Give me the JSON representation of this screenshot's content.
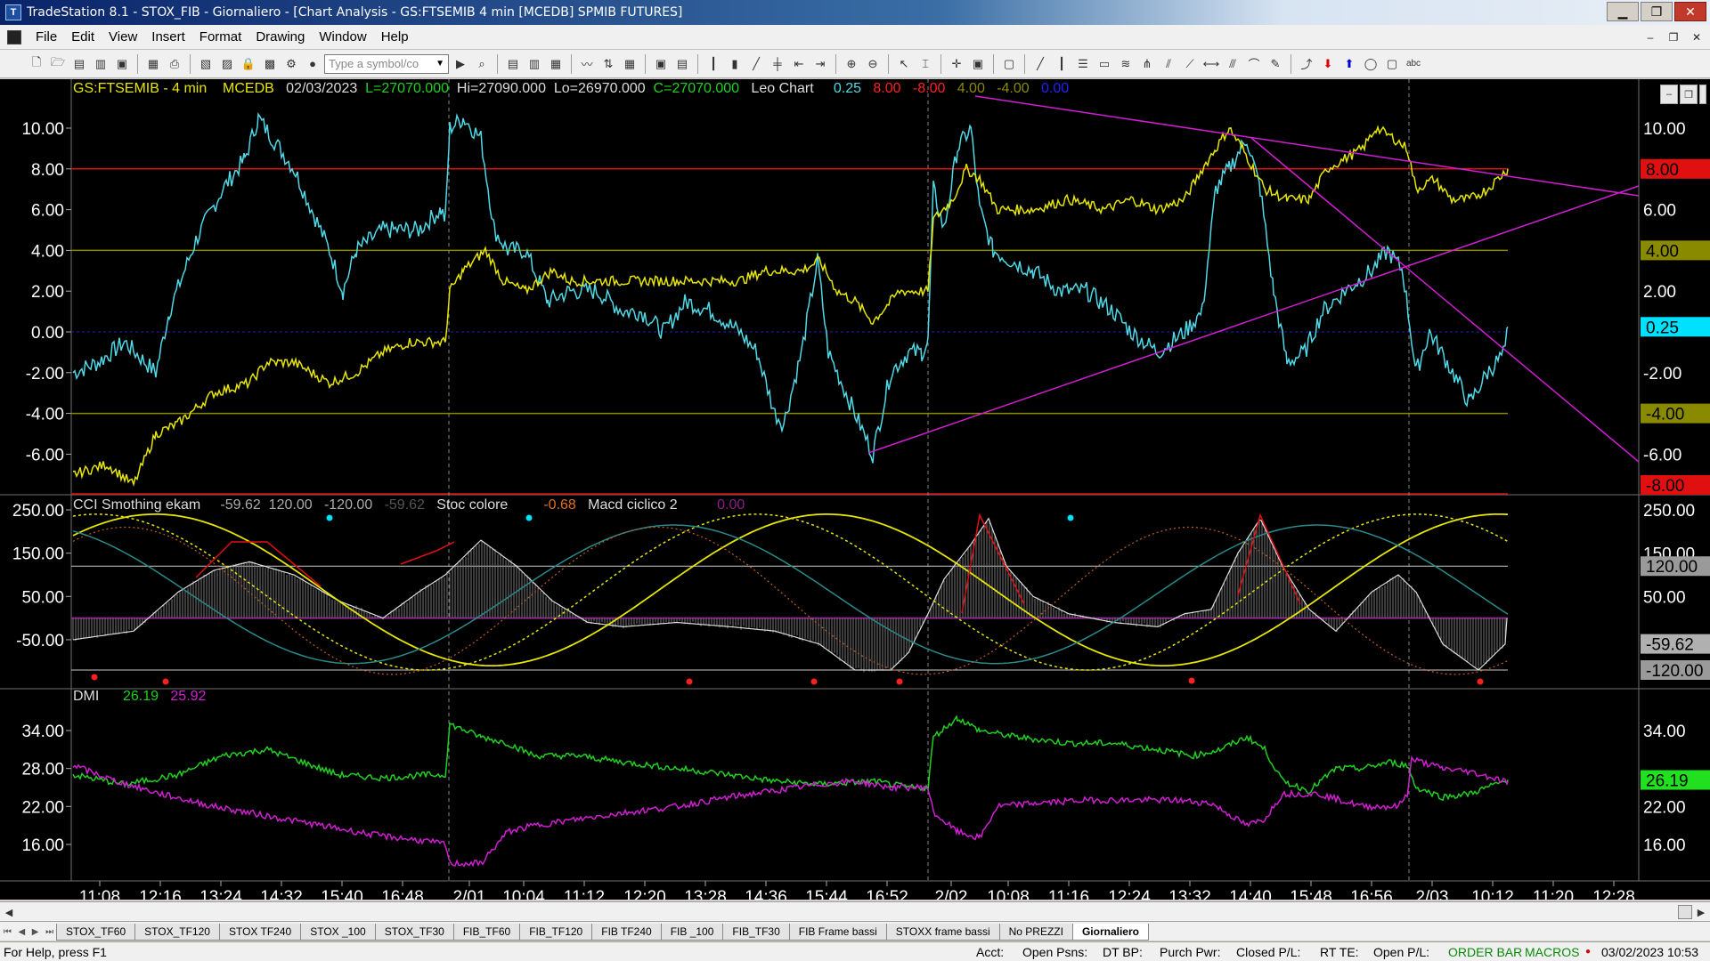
{
  "window": {
    "title": "TradeStation 8.1 - STOX_FIB - Giornaliero - [Chart Analysis - GS:FTSEMIB  4 min  [MCEDB] SPMIB FUTURES]",
    "min": "▁",
    "max": "❐",
    "close": "✕"
  },
  "menu": [
    "File",
    "Edit",
    "View",
    "Insert",
    "Format",
    "Drawing",
    "Window",
    "Help"
  ],
  "toolbar": {
    "symbol_placeholder": "Type a symbol/co"
  },
  "chart": {
    "header": {
      "symbol": "GS:FTSEMIB - 4 min",
      "source": "MCEDB",
      "date": "02/03/2023",
      "last": "L=27070.000",
      "hi": "Hi=27090.000",
      "lo": "Lo=26970.000",
      "close": "C=27070.000",
      "study": "Leo Chart",
      "v1": "0.25",
      "v2": "8.00",
      "v3": "-8.00",
      "v4": "4.00",
      "v5": "-4.00",
      "v6": "0.00"
    },
    "pane1": {
      "yticks": [
        "10.00",
        "8.00",
        "6.00",
        "4.00",
        "2.00",
        "0.00",
        "-2.00",
        "-4.00",
        "-6.00"
      ],
      "rticks": [
        "10.00",
        "6.00",
        "2.00",
        "-2.00",
        "-6.00"
      ],
      "badges": {
        "b8": "8.00",
        "b4": "4.00",
        "b025": "0.25",
        "bm4": "-4.00",
        "bm8": "-8.00"
      }
    },
    "pane2": {
      "title": "CCI Smothing ekam",
      "v1": "-59.62",
      "v2": "120.00",
      "v3": "-120.00",
      "v4": "-59.62",
      "study2": "Stoc colore",
      "v5": "-0.68",
      "study3": "Macd ciclico 2",
      "v6": "0.00",
      "yticks": [
        "250.00",
        "150.00",
        "50.00",
        "-50.00"
      ],
      "rticks": [
        "250.00",
        "150.00",
        "50.00"
      ],
      "badges": {
        "b120": "120.00",
        "b59": "-59.62",
        "bm120": "-120.00"
      }
    },
    "pane3": {
      "title": "DMI",
      "v1": "26.19",
      "v2": "25.92",
      "yticks": [
        "34.00",
        "28.00",
        "22.00",
        "16.00"
      ],
      "rticks": [
        "34.00",
        "22.00",
        "16.00"
      ],
      "badge": "26.19"
    },
    "xticks": [
      "11:08",
      "12:16",
      "13:24",
      "14:32",
      "15:40",
      "16:48",
      "2/01",
      "10:04",
      "11:12",
      "12:20",
      "13:28",
      "14:36",
      "15:44",
      "16:52",
      "2/02",
      "10:08",
      "11:16",
      "12:24",
      "13:32",
      "14:40",
      "15:48",
      "16:56",
      "2/03",
      "10:12",
      "11:20",
      "12:28"
    ]
  },
  "tabs": [
    "STOX_TF60",
    "STOX_TF120",
    "STOX TF240",
    "STOX _100",
    "STOX_TF30",
    "FIB_TF60",
    "FIB_TF120",
    "FIB TF240",
    "FIB _100",
    "FIB_TF30",
    "FIB Frame bassi",
    "STOXX frame bassi",
    "No PREZZI",
    "Giornaliero"
  ],
  "status": {
    "help": "For Help, press F1",
    "acct": "Acct:",
    "open_psns": "Open Psns:",
    "dt_bp": "DT BP:",
    "purch": "Purch Pwr:",
    "closed_pl": "Closed P/L:",
    "rt_te": "RT TE:",
    "open_pl": "Open P/L:",
    "orderbar": "ORDER BAR",
    "macros": "MACROS",
    "datetime": "03/02/2023 10:53"
  },
  "colors": {
    "cyan": "#4fd8e6",
    "yellow": "#e6e600",
    "magenta": "#d21ed2",
    "red": "#ff2020",
    "green": "#20d020",
    "olive": "#8a8a00",
    "grid": "#606060"
  }
}
